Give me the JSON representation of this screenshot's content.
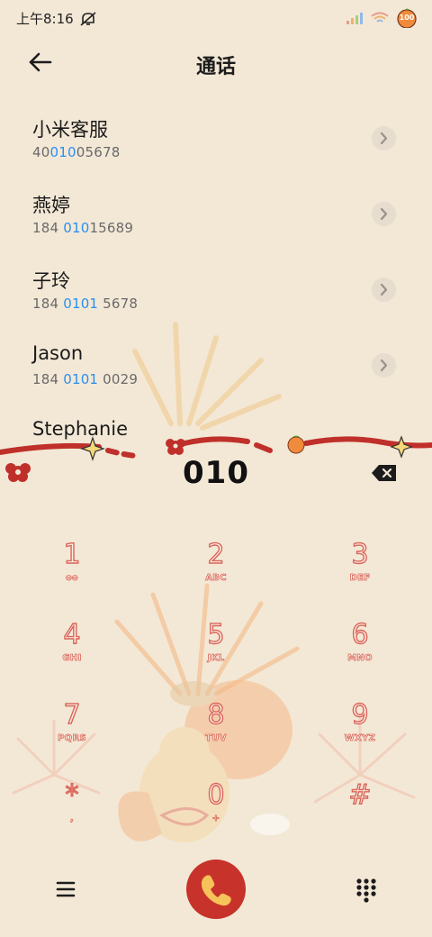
{
  "status_bar": {
    "time": "上午8:16",
    "icons": [
      "mute-icon",
      "signal-icon",
      "wifi-icon",
      "battery-icon"
    ],
    "battery_level": "100"
  },
  "header": {
    "back_icon": "arrow-left-icon",
    "title": "通话"
  },
  "search_query": "010",
  "results": [
    {
      "name": "小米客服",
      "number_pre": "40",
      "number_hl": "010",
      "number_post": "05678"
    },
    {
      "name": "燕婷",
      "number_pre": "184 ",
      "number_hl": "010",
      "number_post": "15689"
    },
    {
      "name": "子玲",
      "number_pre": "184 ",
      "number_hl": "0101",
      "number_post": " 5678"
    },
    {
      "name": "Jason",
      "number_pre": "184 ",
      "number_hl": "0101",
      "number_post": " 0029"
    },
    {
      "name": "Stephanie"
    }
  ],
  "keypad": [
    {
      "digit": "1",
      "letters": "ᴑᴑ"
    },
    {
      "digit": "2",
      "letters": "ABC"
    },
    {
      "digit": "3",
      "letters": "DEF"
    },
    {
      "digit": "4",
      "letters": "GHI"
    },
    {
      "digit": "5",
      "letters": "JKL"
    },
    {
      "digit": "6",
      "letters": "MNO"
    },
    {
      "digit": "7",
      "letters": "PQRS"
    },
    {
      "digit": "8",
      "letters": "TUV"
    },
    {
      "digit": "9",
      "letters": "WXYZ"
    },
    {
      "digit": "*",
      "letters": ","
    },
    {
      "digit": "0",
      "letters": "+"
    },
    {
      "digit": "#",
      "letters": ""
    }
  ],
  "bottom_bar": {
    "menu_icon": "hamburger-menu-icon",
    "call_icon": "phone-icon",
    "dialpad_icon": "dialpad-icon"
  },
  "colors": {
    "background": "#f3e8d6",
    "accent_red": "#c7322a",
    "highlight_blue": "#2a8ff0",
    "key_outline": "#d9655a"
  }
}
